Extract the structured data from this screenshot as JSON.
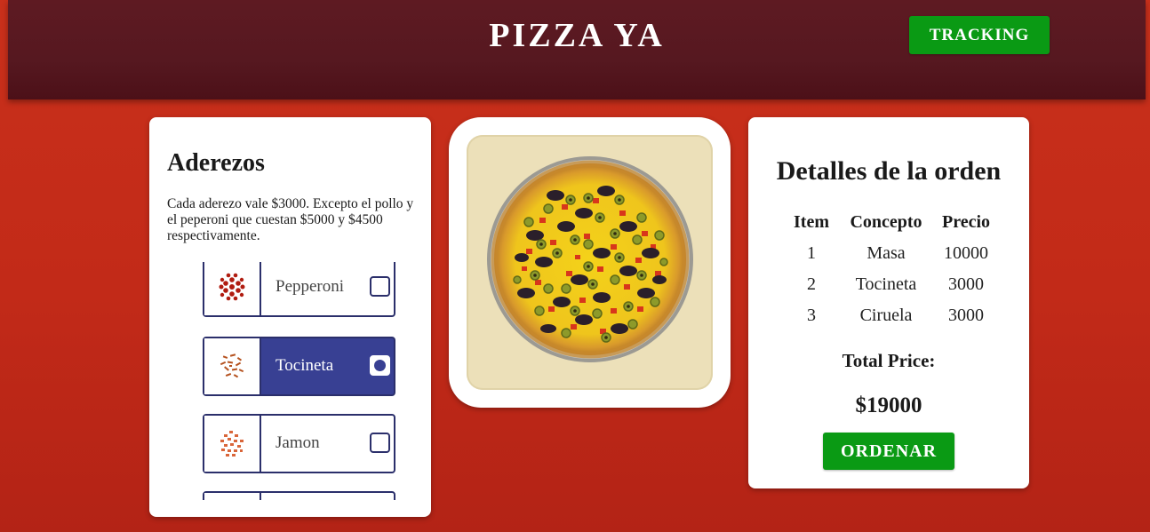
{
  "header": {
    "brand": "PIZZA YA",
    "tracking_label": "TRACKING"
  },
  "toppings_panel": {
    "title": "Aderezos",
    "description": "Cada aderezo vale $3000. Excepto el pollo y el peperoni que cuestan $5000 y $4500 respectivamente.",
    "items": [
      {
        "label": "Pepperoni",
        "selected": false,
        "icon": "pepperoni-icon"
      },
      {
        "label": "Tocineta",
        "selected": true,
        "icon": "bacon-icon"
      },
      {
        "label": "Jamon",
        "selected": false,
        "icon": "ham-icon"
      }
    ]
  },
  "order": {
    "title": "Detalles de la orden",
    "headers": [
      "Item",
      "Concepto",
      "Precio"
    ],
    "rows": [
      {
        "item": "1",
        "concepto": "Masa",
        "precio": "10000"
      },
      {
        "item": "2",
        "concepto": "Tocineta",
        "precio": "3000"
      },
      {
        "item": "3",
        "concepto": "Ciruela",
        "precio": "3000"
      }
    ],
    "total_label": "Total Price:",
    "total_value": "$19000",
    "order_button": "ORDENAR"
  },
  "colors": {
    "accent_green": "#0a9a14",
    "selected_blue": "#384093",
    "header": "#5a1820"
  }
}
